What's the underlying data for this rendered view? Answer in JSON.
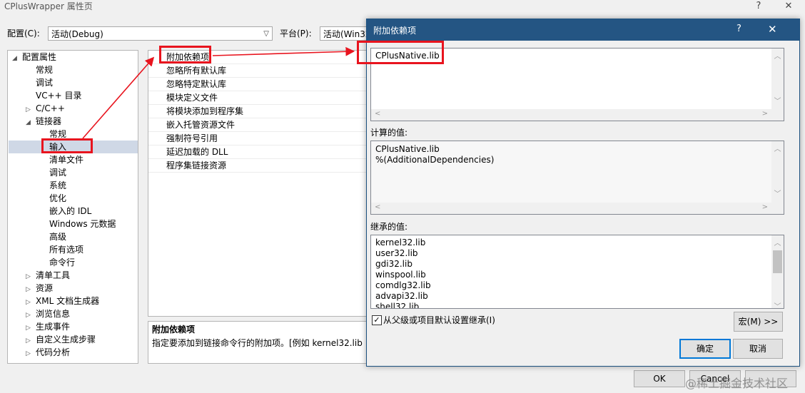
{
  "window": {
    "title": "CPlusWrapper 属性页",
    "help": "?",
    "close": "✕"
  },
  "config": {
    "label": "配置(C):",
    "value": "活动(Debug)",
    "platform_label": "平台(P):",
    "platform_value": "活动(Win32"
  },
  "tree": [
    {
      "label": "配置属性",
      "exp": "◢",
      "level": 0
    },
    {
      "label": "常规",
      "exp": "",
      "level": 1
    },
    {
      "label": "调试",
      "exp": "",
      "level": 1
    },
    {
      "label": "VC++ 目录",
      "exp": "",
      "level": 1
    },
    {
      "label": "C/C++",
      "exp": "▷",
      "level": 1
    },
    {
      "label": "链接器",
      "exp": "◢",
      "level": 1
    },
    {
      "label": "常规",
      "exp": "",
      "level": 2
    },
    {
      "label": "输入",
      "exp": "",
      "level": 2,
      "selected": true
    },
    {
      "label": "清单文件",
      "exp": "",
      "level": 2
    },
    {
      "label": "调试",
      "exp": "",
      "level": 2
    },
    {
      "label": "系统",
      "exp": "",
      "level": 2
    },
    {
      "label": "优化",
      "exp": "",
      "level": 2
    },
    {
      "label": "嵌入的 IDL",
      "exp": "",
      "level": 2
    },
    {
      "label": "Windows 元数据",
      "exp": "",
      "level": 2
    },
    {
      "label": "高级",
      "exp": "",
      "level": 2
    },
    {
      "label": "所有选项",
      "exp": "",
      "level": 2
    },
    {
      "label": "命令行",
      "exp": "",
      "level": 2
    },
    {
      "label": "清单工具",
      "exp": "▷",
      "level": 1
    },
    {
      "label": "资源",
      "exp": "▷",
      "level": 1
    },
    {
      "label": "XML 文档生成器",
      "exp": "▷",
      "level": 1
    },
    {
      "label": "浏览信息",
      "exp": "▷",
      "level": 1
    },
    {
      "label": "生成事件",
      "exp": "▷",
      "level": 1
    },
    {
      "label": "自定义生成步骤",
      "exp": "▷",
      "level": 1
    },
    {
      "label": "代码分析",
      "exp": "▷",
      "level": 1
    }
  ],
  "props": [
    "附加依赖项",
    "忽略所有默认库",
    "忽略特定默认库",
    "模块定义文件",
    "将模块添加到程序集",
    "嵌入托管资源文件",
    "强制符号引用",
    "延迟加载的 DLL",
    "程序集链接资源"
  ],
  "description": {
    "title": "附加依赖项",
    "text": "指定要添加到链接命令行的附加项。[例如 kernel32.lib"
  },
  "main_buttons": {
    "ok": "OK",
    "cancel": "Cancel"
  },
  "dialog": {
    "title": "附加依赖项",
    "help": "?",
    "close": "✕",
    "input_value": "CPlusNative.lib",
    "computed_label": "计算的值:",
    "computed_values": [
      "CPlusNative.lib",
      "%(AdditionalDependencies)"
    ],
    "inherited_label": "继承的值:",
    "inherited_values": [
      "kernel32.lib",
      "user32.lib",
      "gdi32.lib",
      "winspool.lib",
      "comdlg32.lib",
      "advapi32.lib",
      "shell32.lib"
    ],
    "inherit_checkbox_label": "从父级或项目默认设置继承(I)",
    "inherit_checked": true,
    "macro_button": "宏(M) >>",
    "ok_button": "确定",
    "cancel_button": "取消"
  },
  "watermark": "@稀土掘金技术社区",
  "colors": {
    "highlight": "#e8141e",
    "dialog_title_bg": "#245583"
  }
}
